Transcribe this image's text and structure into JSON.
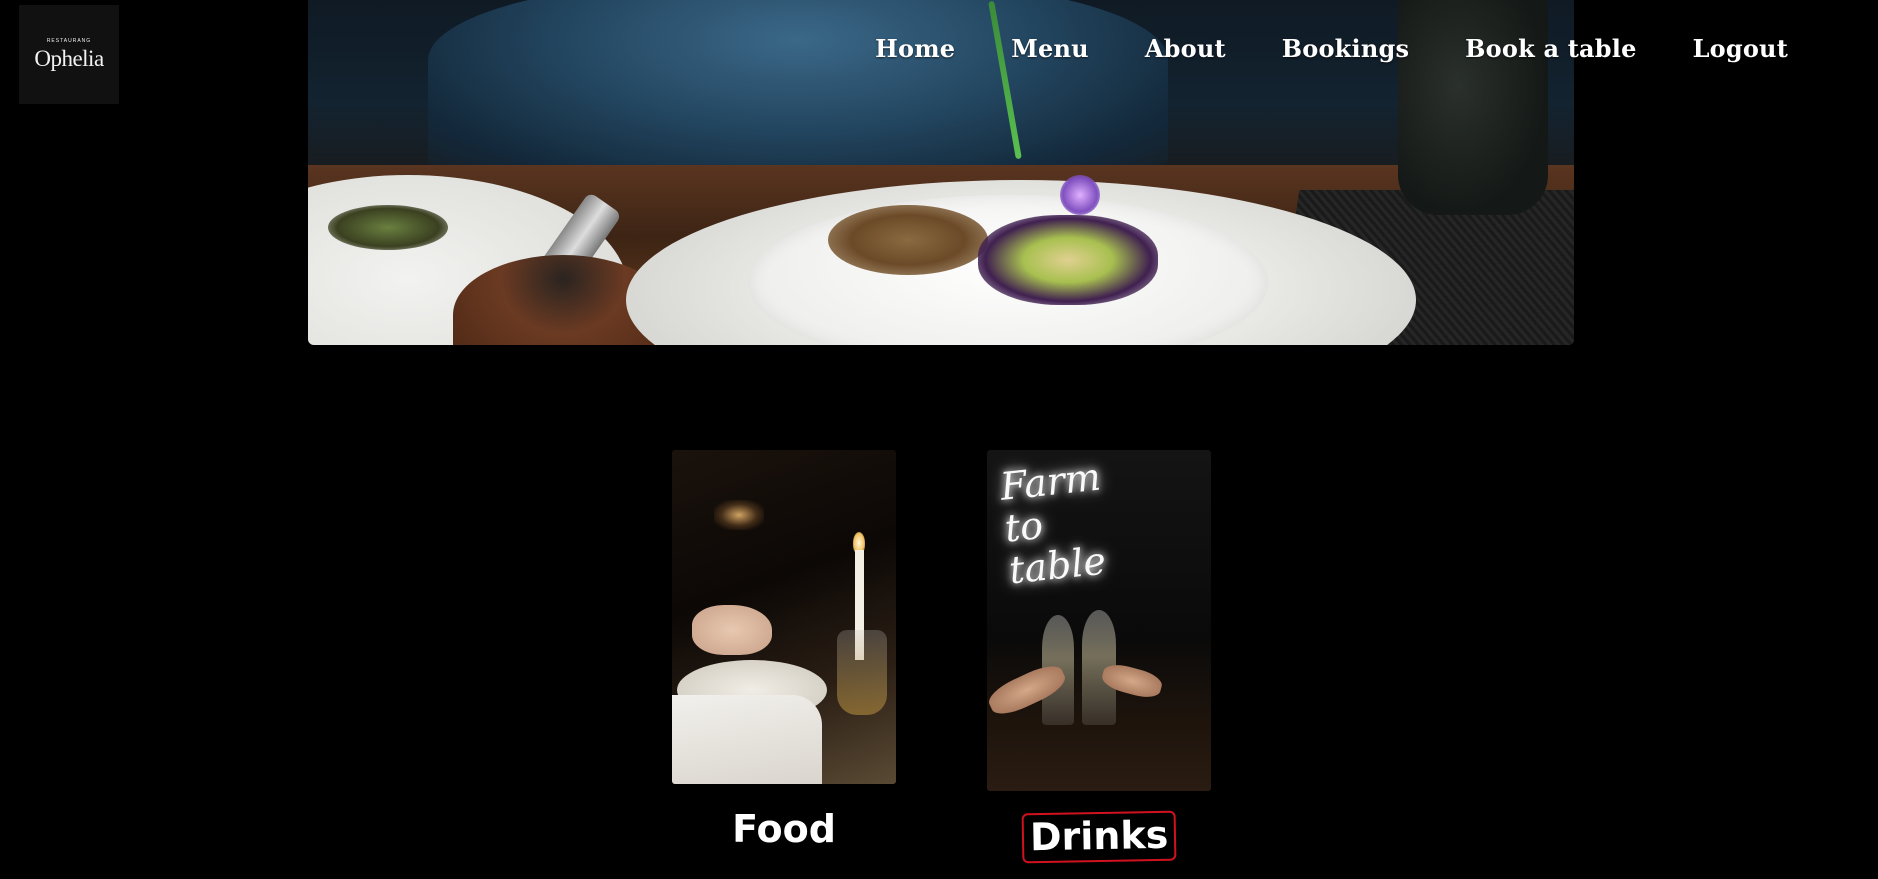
{
  "brand": {
    "tagline": "RESTAURANG",
    "name": "Ophelia"
  },
  "nav": {
    "items": [
      {
        "label": "Home"
      },
      {
        "label": "Menu"
      },
      {
        "label": "About"
      },
      {
        "label": "Bookings"
      },
      {
        "label": "Book a table"
      },
      {
        "label": "Logout"
      }
    ]
  },
  "hero": {
    "image_icon": "plated-dish-photo-icon"
  },
  "categories": [
    {
      "label": "Food",
      "image_icon": "dinner-candle-photo-icon"
    },
    {
      "label": "Drinks",
      "image_icon": "wine-toast-photo-icon",
      "highlighted": true,
      "highlight_color": "#d0121e"
    }
  ],
  "drinks_neon_text": "Farm to table"
}
